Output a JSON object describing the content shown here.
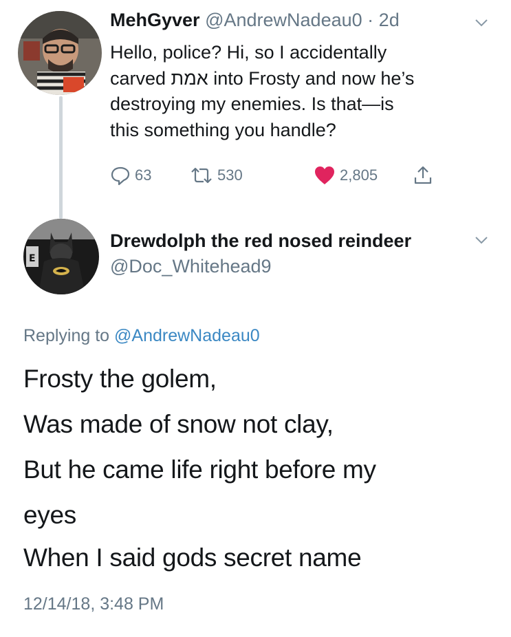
{
  "tweet": {
    "author_name": "MehGyver",
    "author_handle": "@AndrewNadeau0",
    "sep": "·",
    "age": "2d",
    "text_lines": [
      "Hello, police? Hi, so I accidentally",
      "carved אמת into Frosty and now he’s",
      "destroying my enemies. Is that—is",
      "this something you handle?"
    ],
    "replies": "63",
    "retweets": "530",
    "likes": "2,805"
  },
  "reply": {
    "author_name": "Drewdolph the red nosed reindeer",
    "author_handle": "@Doc_Whitehead9",
    "replying_prefix": "Replying to",
    "replying_handle": "@AndrewNadeau0",
    "lines": [
      "Frosty the golem,",
      "Was made of snow not clay,",
      "But he came life right before my",
      "eyes",
      "When I said gods secret name"
    ],
    "timestamp": "12/14/18, 3:48 PM"
  },
  "colors": {
    "muted": "#657786",
    "text": "#14171a",
    "like": "#e0245e",
    "link": "#3b88c3",
    "thread_line": "#cfd6db"
  },
  "icons": [
    "reply-icon",
    "retweet-icon",
    "heart-icon",
    "share-icon",
    "chevron-down-icon"
  ]
}
